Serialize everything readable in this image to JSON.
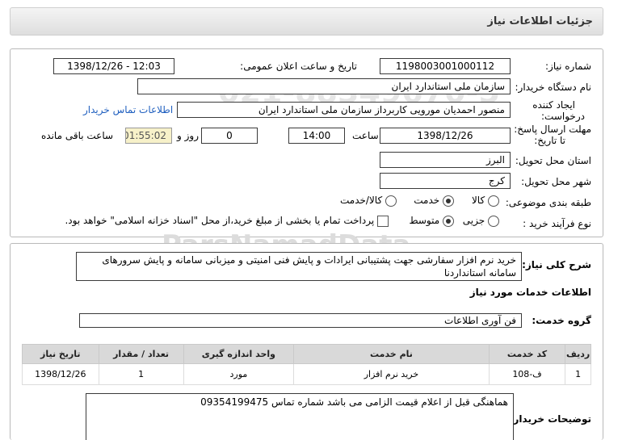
{
  "header": {
    "title": "جزئیات اطلاعات نیاز"
  },
  "watermark": {
    "phone_top": "021-88349670-5",
    "brand": "ParsNamadData",
    "persian_brand": "پارس نماد داده",
    "tagline1": "پایگاه اطلاع رسانی مناقصه و مزایده",
    "phone_bottom": "021-88349670-5"
  },
  "info": {
    "need_number_label": "شماره نیاز:",
    "need_number": "1198003001000112",
    "announce_label": "تاریخ و ساعت اعلان عمومی:",
    "announce_value": "1398/12/26 - 12:03",
    "buyer_org_label": "نام دستگاه خریدار:",
    "buyer_org": "سازمان ملی استاندارد ایران",
    "creator_label_1": "ایجاد کننده",
    "creator_label_2": "درخواست:",
    "creator": "منصور احمدیان مورویی کاربرداز سازمان ملی استاندارد ایران",
    "contact_link": "اطلاعات تماس خریدار",
    "deadline_label_1": "مهلت ارسال پاسخ:",
    "deadline_label_2": "تا تاریخ:",
    "deadline_date": "1398/12/26",
    "time_label": "ساعت",
    "deadline_time": "14:00",
    "days_value": "0",
    "days_label": "روز و",
    "remaining_time": "01:55:02",
    "remaining_label": "ساعت باقی مانده",
    "province_label": "استان محل تحویل:",
    "province": "البرز",
    "city_label": "شهر محل تحویل:",
    "city": "کرج",
    "category_label": "طبقه بندی موضوعی:",
    "category_options": [
      "کالا",
      "خدمت",
      "کالا/خدمت"
    ],
    "category_selected": "خدمت",
    "process_label": "نوع فرآیند خرید :",
    "process_options": [
      "جزیی",
      "متوسط"
    ],
    "process_selected": "متوسط",
    "payment_note": "پرداخت تمام یا بخشی از مبلغ خرید،از محل \"اسناد خزانه اسلامی\" خواهد بود."
  },
  "details": {
    "summary_label": "شرح کلی نیاز:",
    "summary": "خرید نرم افزار سفارشی جهت پشتیبانی ایرادات و پایش فنی امنیتی و میزبانی سامانه و پایش سرورهای سامانه استانداردنا",
    "services_heading": "اطلاعات خدمات مورد نیاز",
    "service_group_label": "گروه خدمت:",
    "service_group": "فن آوری اطلاعات",
    "table": {
      "headers": [
        "ردیف",
        "کد خدمت",
        "نام خدمت",
        "واحد اندازه گیری",
        "تعداد / مقدار",
        "تاریخ نیاز"
      ],
      "rows": [
        [
          "1",
          "ف-108",
          "خرید نرم افزار",
          "مورد",
          "1",
          "1398/12/26"
        ]
      ]
    },
    "buyer_notes_label": "توضیحات خریدار:",
    "buyer_notes": "هماهنگی قبل از اعلام قیمت الزامی می باشد شماره تماس 09354199475"
  }
}
